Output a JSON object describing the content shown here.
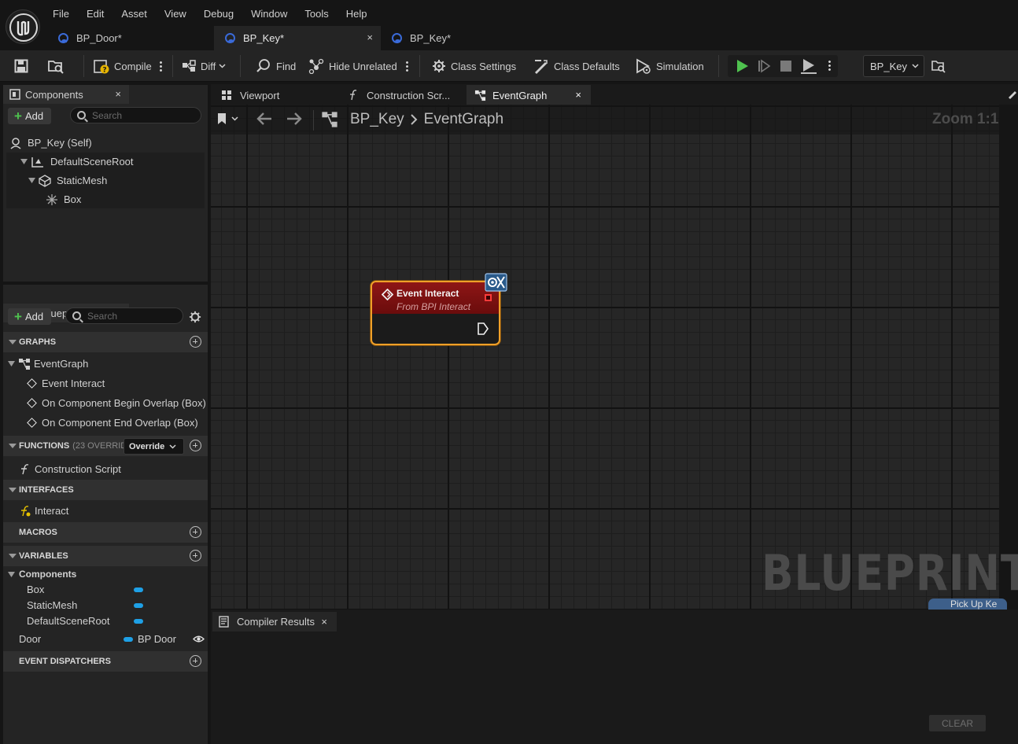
{
  "menu": [
    "File",
    "Edit",
    "Asset",
    "View",
    "Debug",
    "Window",
    "Tools",
    "Help"
  ],
  "doc_tabs": [
    {
      "label": "BP_Door*",
      "active": false
    },
    {
      "label": "BP_Key*",
      "active": true
    },
    {
      "label": "BP_Key*",
      "active": false
    }
  ],
  "close_glyph": "×",
  "toolbar": {
    "compile": "Compile",
    "diff": "Diff",
    "find": "Find",
    "hide_unrelated": "Hide Unrelated",
    "class_settings": "Class Settings",
    "class_defaults": "Class Defaults",
    "simulation": "Simulation",
    "debug_object": "BP_Key"
  },
  "components_panel": {
    "tab_label": "Components",
    "add_label": "Add",
    "search_placeholder": "Search",
    "tree": {
      "self": "BP_Key (Self)",
      "root": "DefaultSceneRoot",
      "mesh": "StaticMesh",
      "box": "Box"
    }
  },
  "my_blueprint": {
    "tab_label": "My Blueprint",
    "add_label": "Add",
    "search_placeholder": "Search",
    "graphs_header": "GRAPHS",
    "event_graph": "EventGraph",
    "events": [
      "Event Interact",
      "On Component Begin Overlap (Box)",
      "On Component End Overlap (Box)"
    ],
    "functions_header": "FUNCTIONS",
    "functions_count": "(23 OVERRIDA",
    "override_label": "Override",
    "construction_script": "Construction Script",
    "interfaces_header": "INTERFACES",
    "interface_item": "Interact",
    "macros_header": "MACROS",
    "variables_header": "VARIABLES",
    "components_category": "Components",
    "component_vars": [
      "Box",
      "StaticMesh",
      "DefaultSceneRoot"
    ],
    "door_var": "Door",
    "door_type": "BP Door",
    "dispatchers_header": "EVENT DISPATCHERS"
  },
  "graph_tabs": {
    "viewport": "Viewport",
    "construction": "Construction Scr...",
    "eventgraph": "EventGraph"
  },
  "graph": {
    "breadcrumb_bp": "BP_Key",
    "breadcrumb_graph": "EventGraph",
    "zoom": "Zoom 1:1",
    "watermark": "BLUEPRINT",
    "comment_stub": "Pick Up Ke"
  },
  "node": {
    "title": "Event Interact",
    "subtitle": "From BPI Interact"
  },
  "compiler": {
    "tab_label": "Compiler Results",
    "clear_label": "CLEAR"
  },
  "colors": {
    "accent_orange": "#f0a028",
    "event_red": "#8e1616",
    "variable_blue": "#1ea0e6",
    "play_green": "#4fc24f"
  }
}
